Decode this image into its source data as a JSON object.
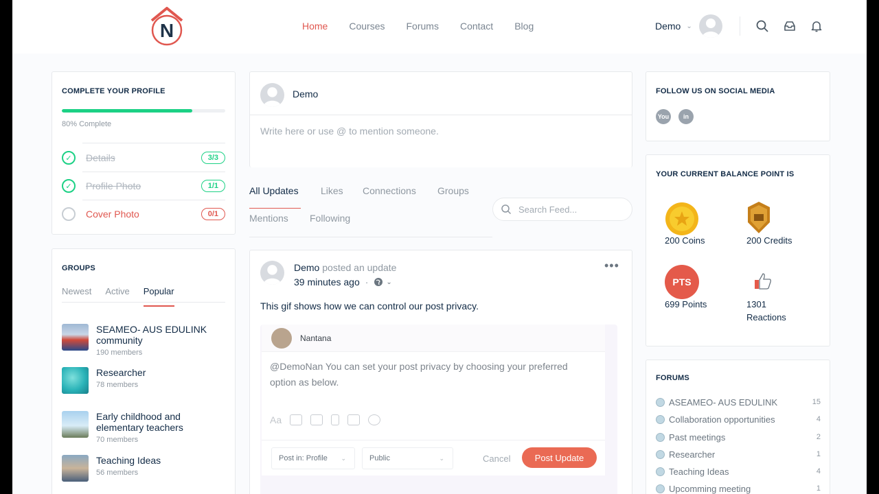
{
  "brand": {
    "accent": "#e0574f",
    "success": "#1cd185",
    "logo_letter": "N"
  },
  "nav": {
    "items": [
      "Home",
      "Courses",
      "Forums",
      "Contact",
      "Blog"
    ],
    "active_index": 0
  },
  "header": {
    "username": "Demo"
  },
  "profile_card": {
    "title": "COMPLETE YOUR PROFILE",
    "progress_percent": 80,
    "progress_text": "80% Complete",
    "steps": [
      {
        "label": "Details",
        "count": "3/3",
        "done": true
      },
      {
        "label": "Profile Photo",
        "count": "1/1",
        "done": true
      },
      {
        "label": "Cover Photo",
        "count": "0/1",
        "done": false
      }
    ]
  },
  "groups_card": {
    "title": "GROUPS",
    "tabs": [
      "Newest",
      "Active",
      "Popular"
    ],
    "active_tab": 2,
    "items": [
      {
        "name": "SEAMEO- AUS EDULINK community",
        "members": "190 members"
      },
      {
        "name": "Researcher",
        "members": "78 members"
      },
      {
        "name": "Early childhood and elementary teachers",
        "members": "70 members"
      },
      {
        "name": "Teaching Ideas",
        "members": "56 members"
      }
    ]
  },
  "composer": {
    "name": "Demo",
    "placeholder": "Write here or use @ to mention someone."
  },
  "feed_tabs": {
    "row1": [
      "All Updates",
      "Likes",
      "Connections",
      "Groups"
    ],
    "row2": [
      "Mentions",
      "Following"
    ],
    "active": "All Updates",
    "search_placeholder": "Search Feed..."
  },
  "post": {
    "author": "Demo",
    "action": "posted an update",
    "time": "39 minutes ago",
    "text": "This gif shows how we can control our post privacy.",
    "gif": {
      "user": "Nantana",
      "message": "@DemoNan  You can set your post privacy by choosing your preferred option as below.",
      "post_in": "Post in: Profile",
      "privacy": "Public",
      "cancel": "Cancel",
      "submit": "Post Update",
      "text_tool": "Aa"
    }
  },
  "social_card": {
    "title": "FOLLOW US ON SOCIAL MEDIA",
    "networks": [
      "youtube-icon",
      "linkedin-icon"
    ],
    "linkedin_label": "in",
    "youtube_label": "You"
  },
  "balance_card": {
    "title": "YOUR CURRENT BALANCE POINT IS",
    "coins": "200 Coins",
    "credits": "200 Credits",
    "points_badge": "PTS",
    "points": "699 Points",
    "reactions_count": "1301",
    "reactions_label": "Reactions"
  },
  "forums_card": {
    "title": "FORUMS",
    "items": [
      {
        "name": "ASEAMEO- AUS EDULINK",
        "count": "15"
      },
      {
        "name": "Collaboration opportunities",
        "count": "4"
      },
      {
        "name": "Past meetings",
        "count": "2"
      },
      {
        "name": "Researcher",
        "count": "1"
      },
      {
        "name": "Teaching Ideas",
        "count": "4"
      },
      {
        "name": "Upcomming meeting",
        "count": "1"
      }
    ]
  }
}
